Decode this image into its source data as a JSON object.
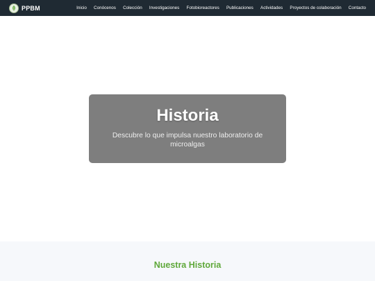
{
  "brand": {
    "name": "PPBM",
    "logo_icon": "leaf-logo-icon"
  },
  "nav": {
    "items": [
      "Inicio",
      "Conócenos",
      "Colección",
      "Investigaciones",
      "Fotobioreactores",
      "Publicaciones",
      "Actividades",
      "Proyectos de colaboración",
      "Contacto"
    ]
  },
  "hero": {
    "title": "Historia",
    "subtitle": "Descubre lo que impulsa nuestro laboratorio de microalgas"
  },
  "section": {
    "title": "Nuestra Historia"
  },
  "colors": {
    "navbar_bg": "#1f2a33",
    "accent_green": "#5fa83a",
    "hero_card_bg": "#5a5a5a",
    "section_bg": "#f6f8fb"
  }
}
